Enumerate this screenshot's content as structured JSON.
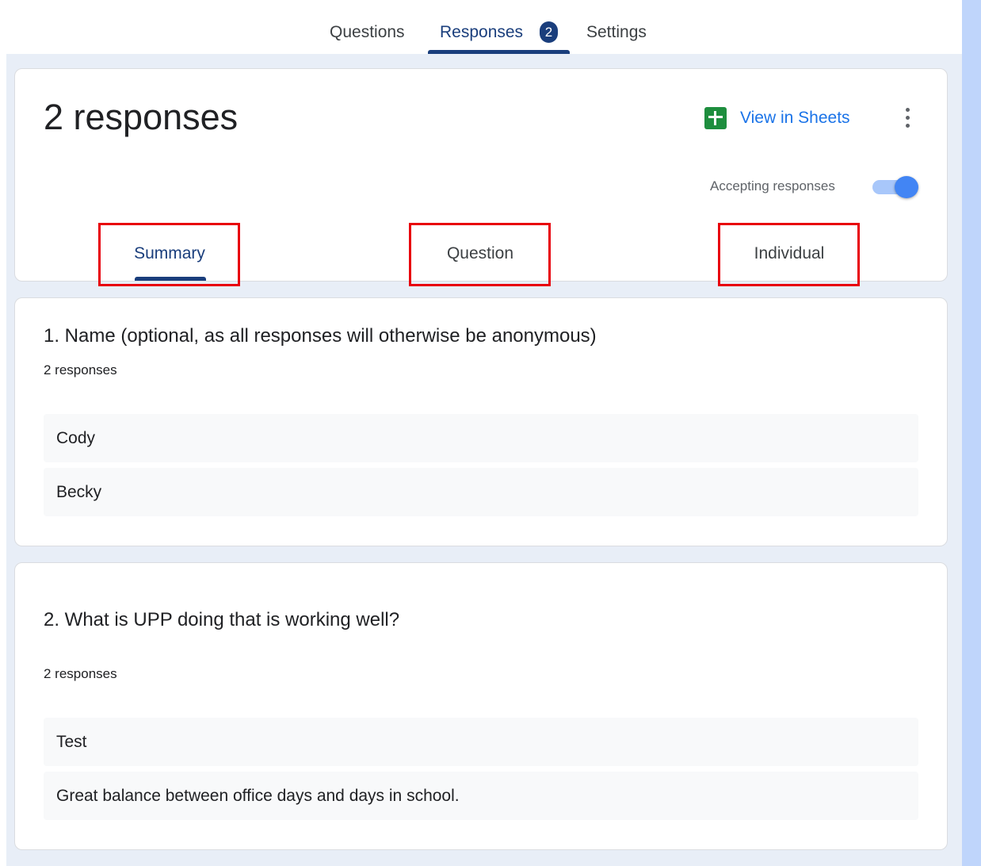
{
  "nav": {
    "tabs": [
      {
        "label": "Questions"
      },
      {
        "label": "Responses",
        "badge": "2"
      },
      {
        "label": "Settings"
      }
    ]
  },
  "header": {
    "response_count": "2 responses",
    "view_in_sheets": "View in Sheets",
    "accepting_label": "Accepting responses",
    "accepting_on": true
  },
  "subtabs": [
    {
      "label": "Summary"
    },
    {
      "label": "Question"
    },
    {
      "label": "Individual"
    }
  ],
  "questions": [
    {
      "title": "1. Name (optional, as all responses will otherwise be anonymous)",
      "count": "2 responses",
      "answers": [
        "Cody",
        "Becky"
      ]
    },
    {
      "title": "2. What is UPP doing that is working well?",
      "count": "2 responses",
      "answers": [
        "Test",
        "Great balance between office days and days in school."
      ]
    }
  ],
  "colors": {
    "accent": "#1a3e7c",
    "link": "#1a73e8",
    "highlight": "#e8000b",
    "sheets_green": "#1e8e3e"
  }
}
